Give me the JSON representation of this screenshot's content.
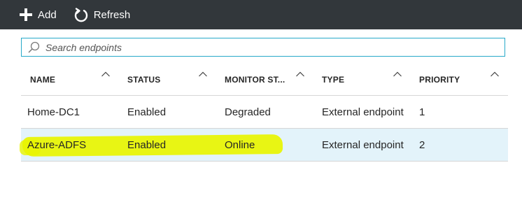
{
  "toolbar": {
    "add_label": "Add",
    "refresh_label": "Refresh"
  },
  "search": {
    "placeholder": "Search endpoints",
    "value": ""
  },
  "table": {
    "columns": [
      {
        "label": "NAME"
      },
      {
        "label": "STATUS"
      },
      {
        "label": "MONITOR ST..."
      },
      {
        "label": "TYPE"
      },
      {
        "label": "PRIORITY"
      }
    ],
    "rows": [
      {
        "name": "Home-DC1",
        "status": "Enabled",
        "monitor": "Degraded",
        "type": "External endpoint",
        "priority": "1",
        "selected": false
      },
      {
        "name": "Azure-ADFS",
        "status": "Enabled",
        "monitor": "Online",
        "type": "External endpoint",
        "priority": "2",
        "selected": true
      }
    ]
  },
  "colors": {
    "toolbar_bg": "#32373b",
    "search_border": "#27a9c9",
    "selected_row_bg": "#e3f3fa",
    "highlight": "#e8f500"
  }
}
